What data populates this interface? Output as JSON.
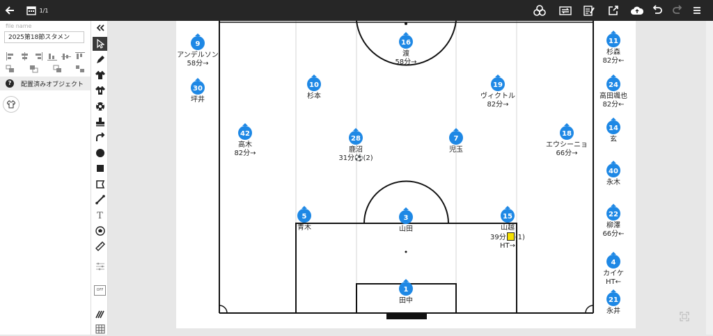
{
  "header": {
    "page_counter": "1/1"
  },
  "file": {
    "label": "file name",
    "value": "2025第18節スタメン"
  },
  "placed_objects": {
    "label": "配置済みオブジェクト",
    "help_glyph": "?"
  },
  "tools": {
    "text_tool_glyph": "T",
    "toggle_label": "OFF"
  },
  "colors": {
    "topbar": "#262626",
    "marker": "#1e88e5",
    "yellow_card": "#f5e000"
  },
  "players": [
    {
      "number": "16",
      "name": "渡",
      "sub": "58分→"
    },
    {
      "number": "10",
      "name": "杉本",
      "sub": ""
    },
    {
      "number": "19",
      "name": "ヴィクトル",
      "sub": "82分→"
    },
    {
      "number": "42",
      "name": "高木",
      "sub": "82分→"
    },
    {
      "number": "28",
      "name": "鹿沼",
      "sub": "31分⚽(2)"
    },
    {
      "number": "7",
      "name": "児玉",
      "sub": ""
    },
    {
      "number": "18",
      "name": "エウシーニョ",
      "sub": "66分→"
    },
    {
      "number": "5",
      "name": "青木",
      "sub": ""
    },
    {
      "number": "3",
      "name": "山田",
      "sub": ""
    },
    {
      "number": "15",
      "name": "山越",
      "sub": "39分",
      "card": "(1)",
      "sub2": "HT→"
    },
    {
      "number": "1",
      "name": "田中",
      "sub": ""
    }
  ],
  "bench_left": [
    {
      "number": "9",
      "name": "アンデルソン",
      "sub": "58分→"
    },
    {
      "number": "30",
      "name": "坪井",
      "sub": ""
    }
  ],
  "bench_right": [
    {
      "number": "11",
      "name": "杉森",
      "sub": "82分←"
    },
    {
      "number": "24",
      "name": "高田颯也",
      "sub": "82分←"
    },
    {
      "number": "14",
      "name": "玄",
      "sub": ""
    },
    {
      "number": "40",
      "name": "永木",
      "sub": ""
    },
    {
      "number": "22",
      "name": "柳澤",
      "sub": "66分←"
    },
    {
      "number": "4",
      "name": "カイケ",
      "sub": "HT←"
    },
    {
      "number": "21",
      "name": "永井",
      "sub": ""
    }
  ]
}
